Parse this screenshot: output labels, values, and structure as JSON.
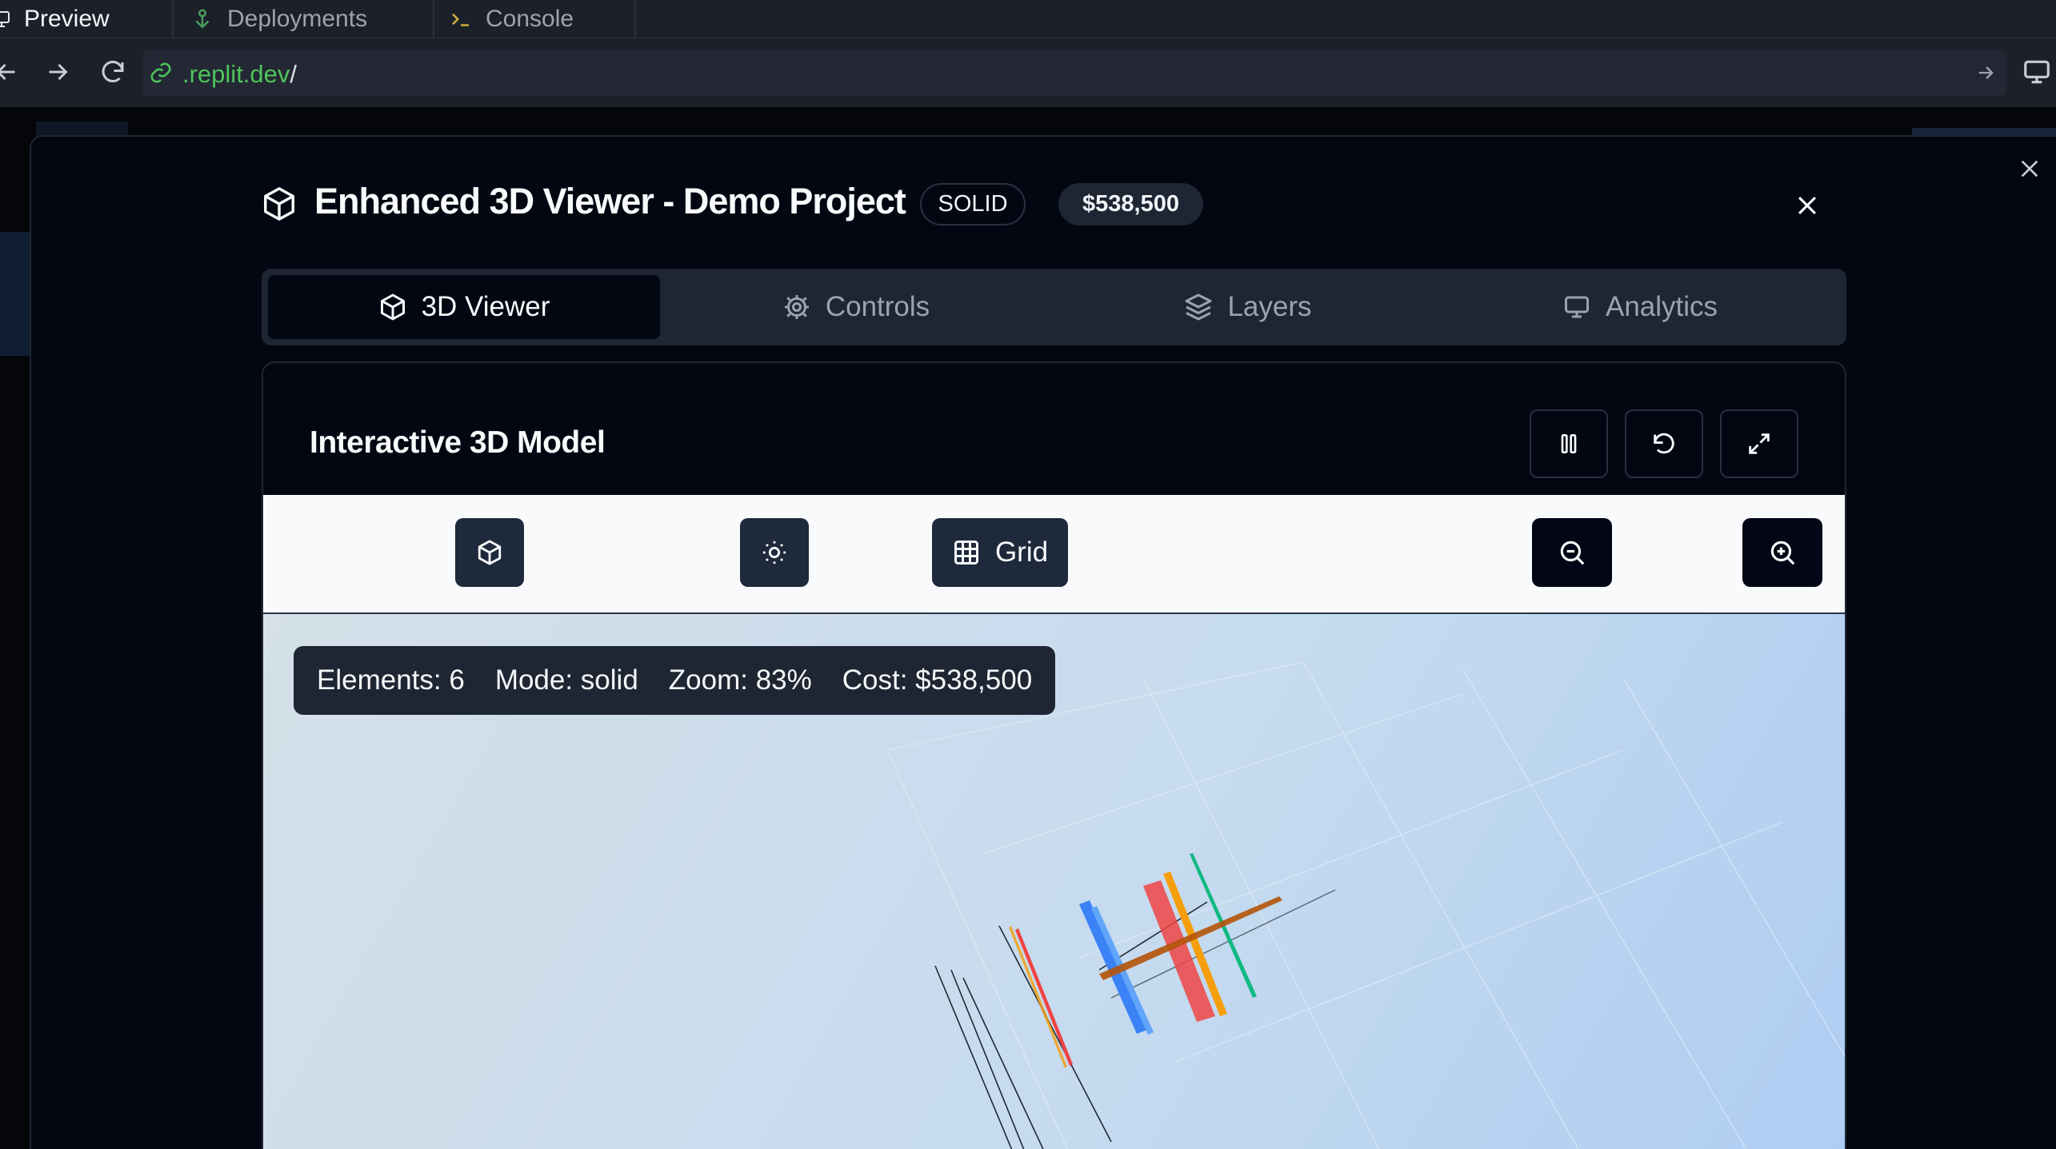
{
  "browser": {
    "tabs": [
      {
        "label": "Preview",
        "icon": "monitor-icon"
      },
      {
        "label": "Deployments",
        "icon": "deployments-icon"
      },
      {
        "label": "Console",
        "icon": "terminal-icon"
      }
    ],
    "url_domain": ".replit.dev",
    "url_path": "/",
    "url_color": "#4ec45a"
  },
  "modal": {
    "title": "Enhanced 3D Viewer - Demo Project",
    "mode_badge": "SOLID",
    "cost_badge": "$538,500",
    "tabs": [
      {
        "label": "3D Viewer",
        "icon": "cube-icon",
        "active": true
      },
      {
        "label": "Controls",
        "icon": "gear-icon",
        "active": false
      },
      {
        "label": "Layers",
        "icon": "layers-icon",
        "active": false
      },
      {
        "label": "Analytics",
        "icon": "monitor-icon",
        "active": false
      }
    ],
    "card_title": "Interactive 3D Model",
    "card_controls": [
      "pause-icon",
      "reset-icon",
      "fullscreen-icon"
    ],
    "toolbar": {
      "buttons": [
        "cube-icon",
        "sun-icon",
        "grid-icon",
        "zoom-out-icon",
        "zoom-in-icon"
      ],
      "grid_label": "Grid"
    },
    "stats": {
      "elements": "Elements: 6",
      "mode": "Mode: solid",
      "zoom": "Zoom: 83%",
      "cost": "Cost: $538,500"
    },
    "colors": {
      "modal_bg": "#030712",
      "tab_bar": "#1e2533",
      "viewport_start": "#d5e0e8",
      "viewport_end": "#aecdf2",
      "element_red": "#ef4444",
      "element_orange": "#f59e0b",
      "element_blue": "#3b82f6",
      "element_green": "#10b981",
      "element_brown": "#b45309"
    }
  }
}
